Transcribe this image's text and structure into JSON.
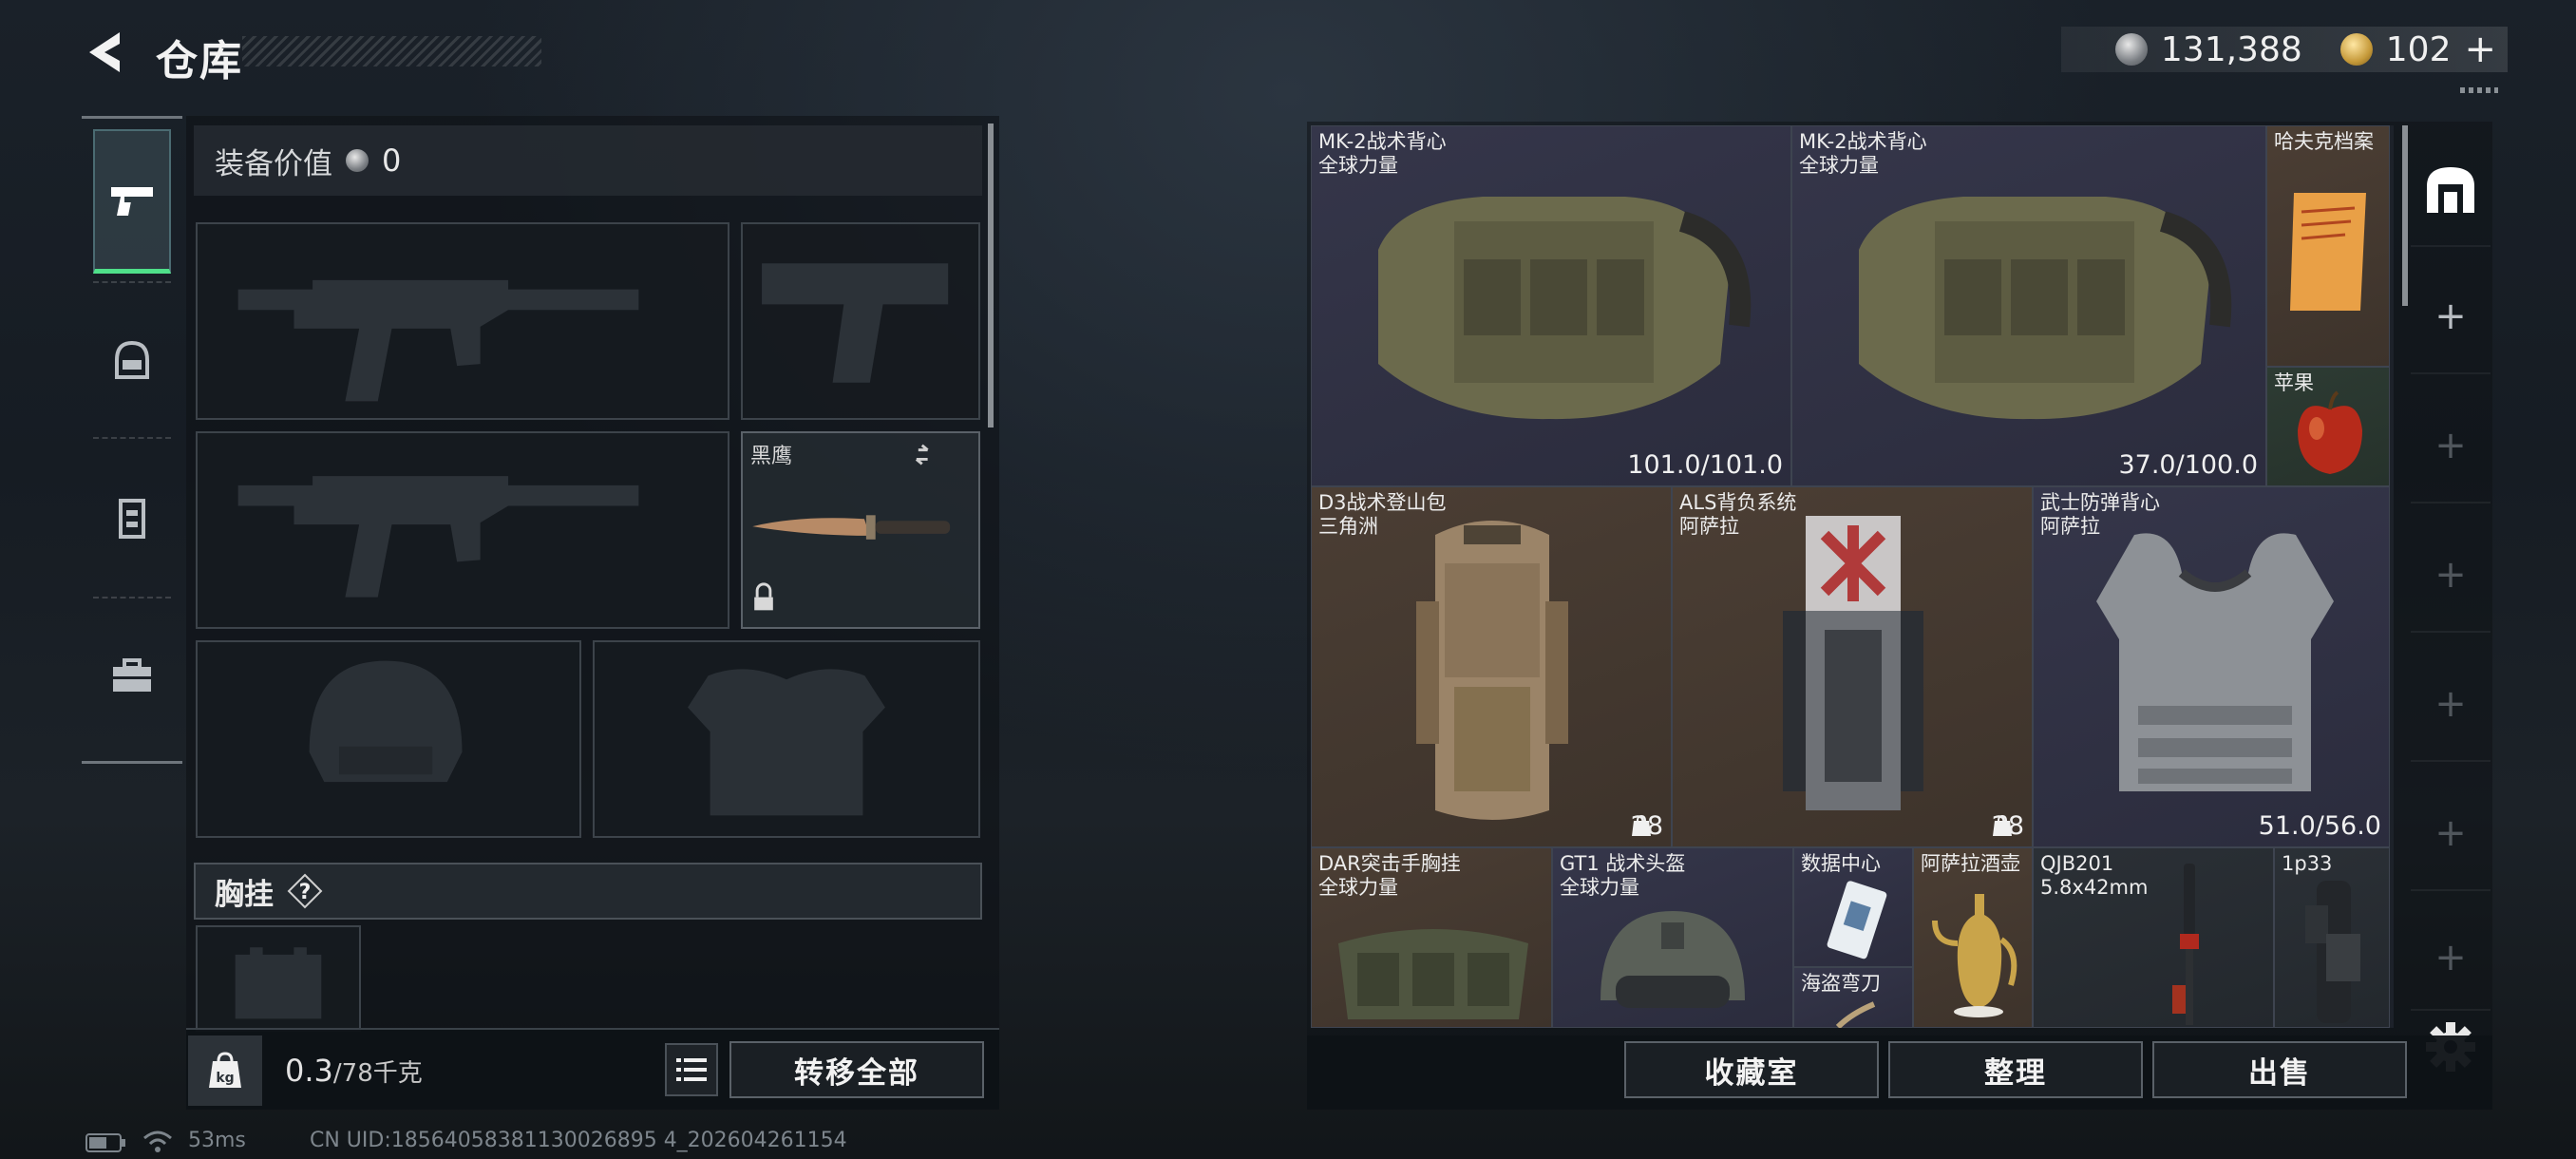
{
  "header": {
    "title": "仓库",
    "currencies": [
      {
        "icon": "silver-coin-icon",
        "value": "131,388"
      },
      {
        "icon": "gold-coin-icon",
        "value": "102"
      }
    ],
    "add_label": "+"
  },
  "left": {
    "tabs": [
      "pistol-tab",
      "helmet-tab",
      "vest-tab",
      "toolbox-tab"
    ],
    "equipment_value_label": "装备价值",
    "equipment_value": "0",
    "knife_slot_label": "黑鹰",
    "section_label": "胸挂",
    "section_help": "?",
    "weight_current": "0.3",
    "weight_max": "/78千克",
    "transfer_all": "转移全部"
  },
  "items": [
    {
      "name": "MK-2战术背心",
      "sub": "全球力量",
      "durability": "101.0/101.0"
    },
    {
      "name": "MK-2战术背心",
      "sub": "全球力量",
      "durability": "37.0/100.0"
    },
    {
      "name": "哈夫克档案",
      "sub": ""
    },
    {
      "name": "苹果",
      "sub": ""
    },
    {
      "name": "D3战术登山包",
      "sub": "三角洲",
      "count": "28"
    },
    {
      "name": "ALS背负系统",
      "sub": "阿萨拉",
      "count": "28"
    },
    {
      "name": "武士防弹背心",
      "sub": "阿萨拉",
      "durability": "51.0/56.0"
    },
    {
      "name": "DAR突击手胸挂",
      "sub": "全球力量"
    },
    {
      "name": "GT1 战术头盔",
      "sub": "全球力量"
    },
    {
      "name": "数据中心",
      "sub": ""
    },
    {
      "name": "阿萨拉酒壶",
      "sub": ""
    },
    {
      "name": "海盗弯刀",
      "sub": ""
    },
    {
      "name": "QJB201",
      "sub": "5.8x42mm"
    },
    {
      "name": "1p33",
      "sub": ""
    }
  ],
  "right": {
    "collection_btn": "收藏室",
    "sort_btn": "整理",
    "sell_btn": "出售",
    "rail_plus": "+"
  },
  "status": {
    "ping": "53ms",
    "uid": "CN UID:18564058381130026895 4_202604261154"
  },
  "colors": {
    "accent_green": "#4fe08a",
    "cell_blue": "#35364a",
    "cell_brown": "#4b3e34",
    "cell_green": "#2d3b33"
  }
}
